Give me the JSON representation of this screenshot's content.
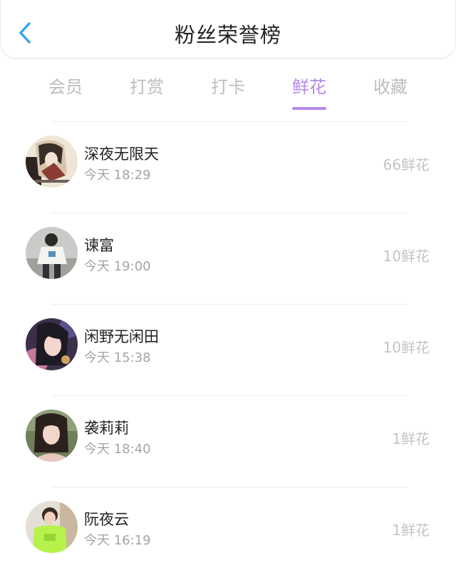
{
  "header": {
    "title": "粉丝荣誉榜",
    "back_icon": "chevron-left-icon",
    "accent_color": "#2ea6ee"
  },
  "tabs": [
    {
      "label": "会员",
      "active": false
    },
    {
      "label": "打赏",
      "active": false
    },
    {
      "label": "打卡",
      "active": false
    },
    {
      "label": "鲜花",
      "active": true
    },
    {
      "label": "收藏",
      "active": false
    }
  ],
  "active_tab_color": "#b48ae8",
  "fans": [
    {
      "name": "深夜无限天",
      "time": "今天 18:29",
      "value": "66鲜花"
    },
    {
      "name": "谏富",
      "time": "今天 19:00",
      "value": "10鲜花"
    },
    {
      "name": "闲野无闲田",
      "time": "今天 15:38",
      "value": "10鲜花"
    },
    {
      "name": "袭莉莉",
      "time": "今天 18:40",
      "value": "1鲜花"
    },
    {
      "name": "阮夜云",
      "time": "今天 16:19",
      "value": "1鲜花"
    }
  ]
}
